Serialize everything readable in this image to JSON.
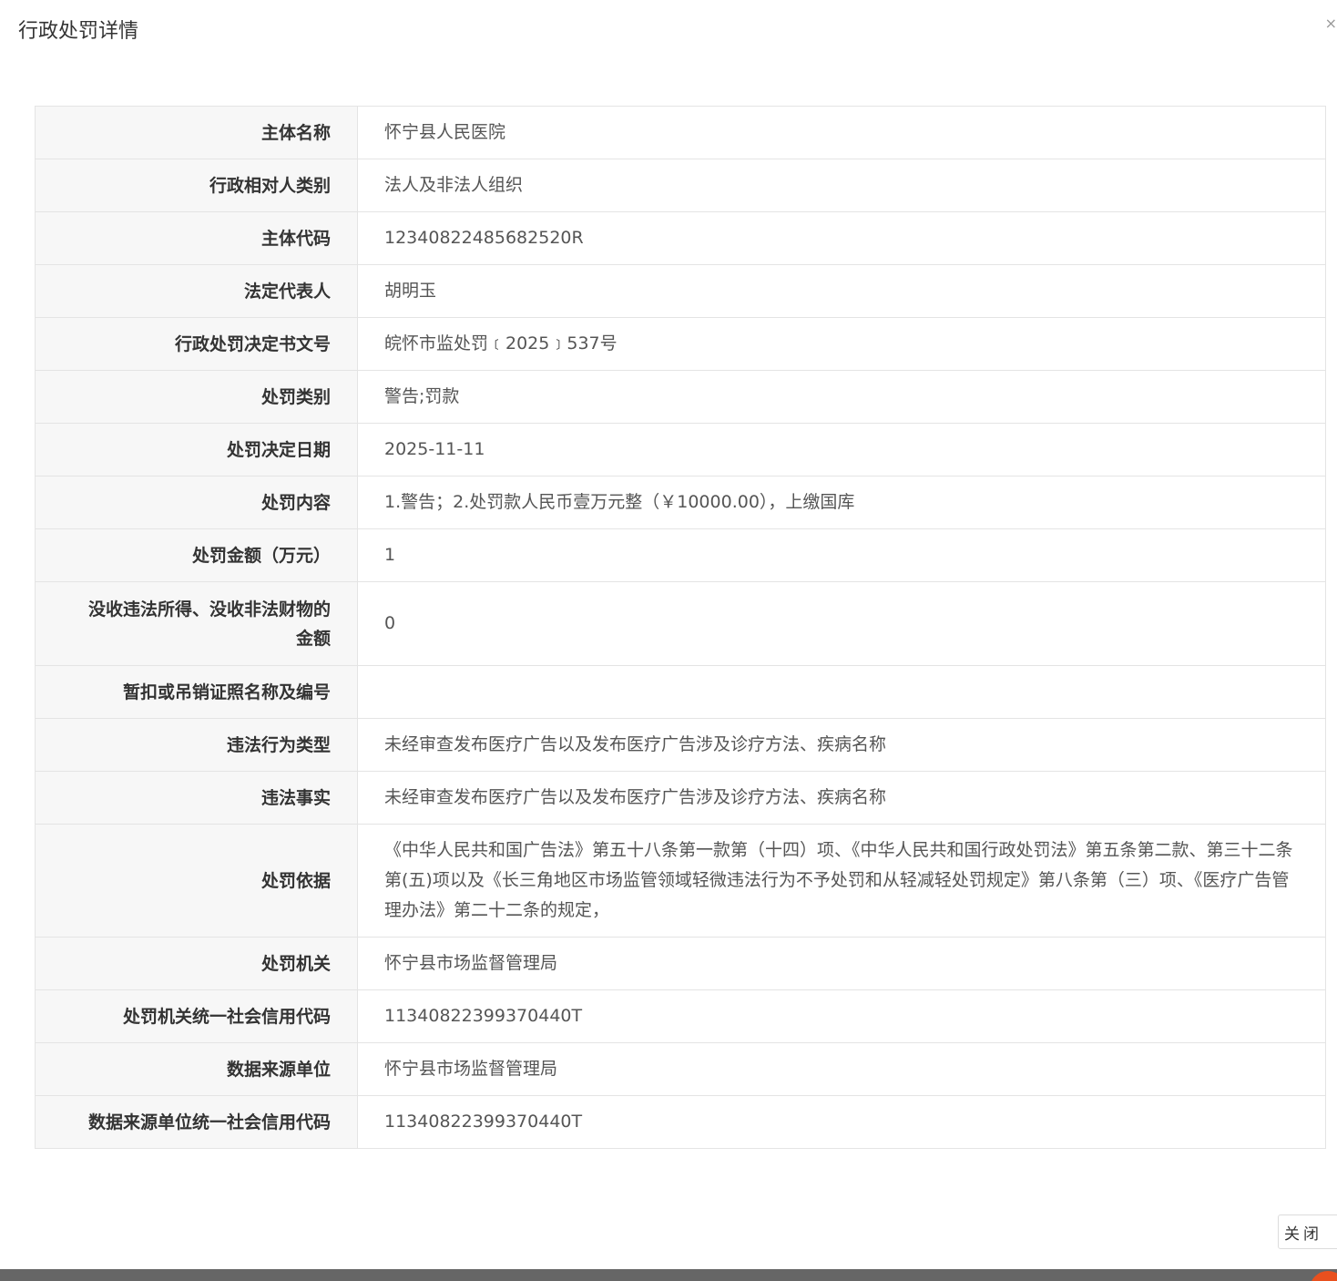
{
  "dialog": {
    "title": "行政处罚详情",
    "close_icon": "×",
    "close_button_label": "关闭"
  },
  "rows": [
    {
      "label": "主体名称",
      "value": "怀宁县人民医院"
    },
    {
      "label": "行政相对人类别",
      "value": "法人及非法人组织"
    },
    {
      "label": "主体代码",
      "value": "12340822485682520R"
    },
    {
      "label": "法定代表人",
      "value": "胡明玉"
    },
    {
      "label": "行政处罚决定书文号",
      "value": "皖怀市监处罚﹝2025﹞537号"
    },
    {
      "label": "处罚类别",
      "value": "警告;罚款"
    },
    {
      "label": "处罚决定日期",
      "value": "2025-11-11"
    },
    {
      "label": "处罚内容",
      "value": "1.警告；2.处罚款人民币壹万元整（￥10000.00），上缴国库"
    },
    {
      "label": "处罚金额（万元）",
      "value": "1"
    },
    {
      "label": "没收违法所得、没收非法财物的金额",
      "value": "0"
    },
    {
      "label": "暂扣或吊销证照名称及编号",
      "value": ""
    },
    {
      "label": "违法行为类型",
      "value": "未经审查发布医疗广告以及发布医疗广告涉及诊疗方法、疾病名称"
    },
    {
      "label": "违法事实",
      "value": "未经审查发布医疗广告以及发布医疗广告涉及诊疗方法、疾病名称"
    },
    {
      "label": "处罚依据",
      "value": "《中华人民共和国广告法》第五十八条第一款第（十四）项、《中华人民共和国行政处罚法》第五条第二款、第三十二条第(五)项以及《长三角地区市场监管领域轻微违法行为不予处罚和从轻减轻处罚规定》第八条第（三）项、《医疗广告管理办法》第二十二条的规定，"
    },
    {
      "label": "处罚机关",
      "value": "怀宁县市场监督管理局"
    },
    {
      "label": "处罚机关统一社会信用代码",
      "value": "11340822399370440T"
    },
    {
      "label": "数据来源单位",
      "value": "怀宁县市场监督管理局"
    },
    {
      "label": "数据来源单位统一社会信用代码",
      "value": "11340822399370440T"
    }
  ]
}
